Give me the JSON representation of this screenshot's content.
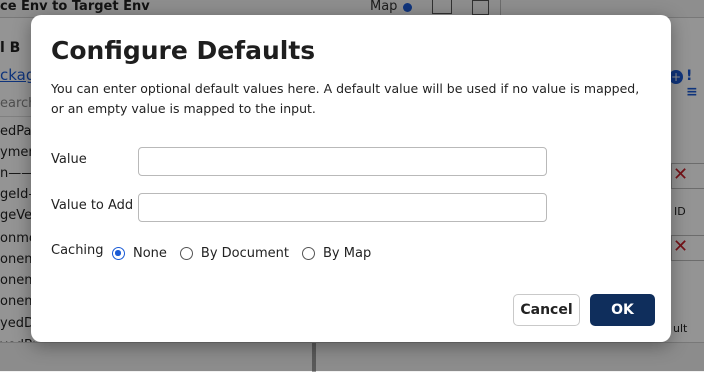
{
  "background": {
    "window_title": "ce Env to Target Env",
    "map_label": "Map",
    "toolbar_text": "l     B",
    "tab_label": "ckag",
    "search_placeholder": "earch",
    "fields": [
      "edPac",
      "ymen",
      "n———",
      "geId–",
      "geVer",
      "onmen",
      "onent",
      "onent",
      "onent",
      "yedDa",
      "yedBy"
    ],
    "right_id_label": "ID",
    "right_ult_label": "ult"
  },
  "dialog": {
    "title": "Configure Defaults",
    "description": "You can enter optional default values here. A default value will be used if no value is mapped, or an empty value is mapped to the input.",
    "value_label": "Value",
    "value_input": "",
    "value_to_add_label": "Value to Add",
    "value_to_add_input": "",
    "caching_label": "Caching",
    "caching_options": [
      {
        "label": "None",
        "selected": true
      },
      {
        "label": "By Document",
        "selected": false
      },
      {
        "label": "By Map",
        "selected": false
      }
    ],
    "cancel_label": "Cancel",
    "ok_label": "OK"
  },
  "colors": {
    "primary_button": "#0f2e5c",
    "radio_accent": "#1a5bd6",
    "close_icon": "#c8202a"
  }
}
